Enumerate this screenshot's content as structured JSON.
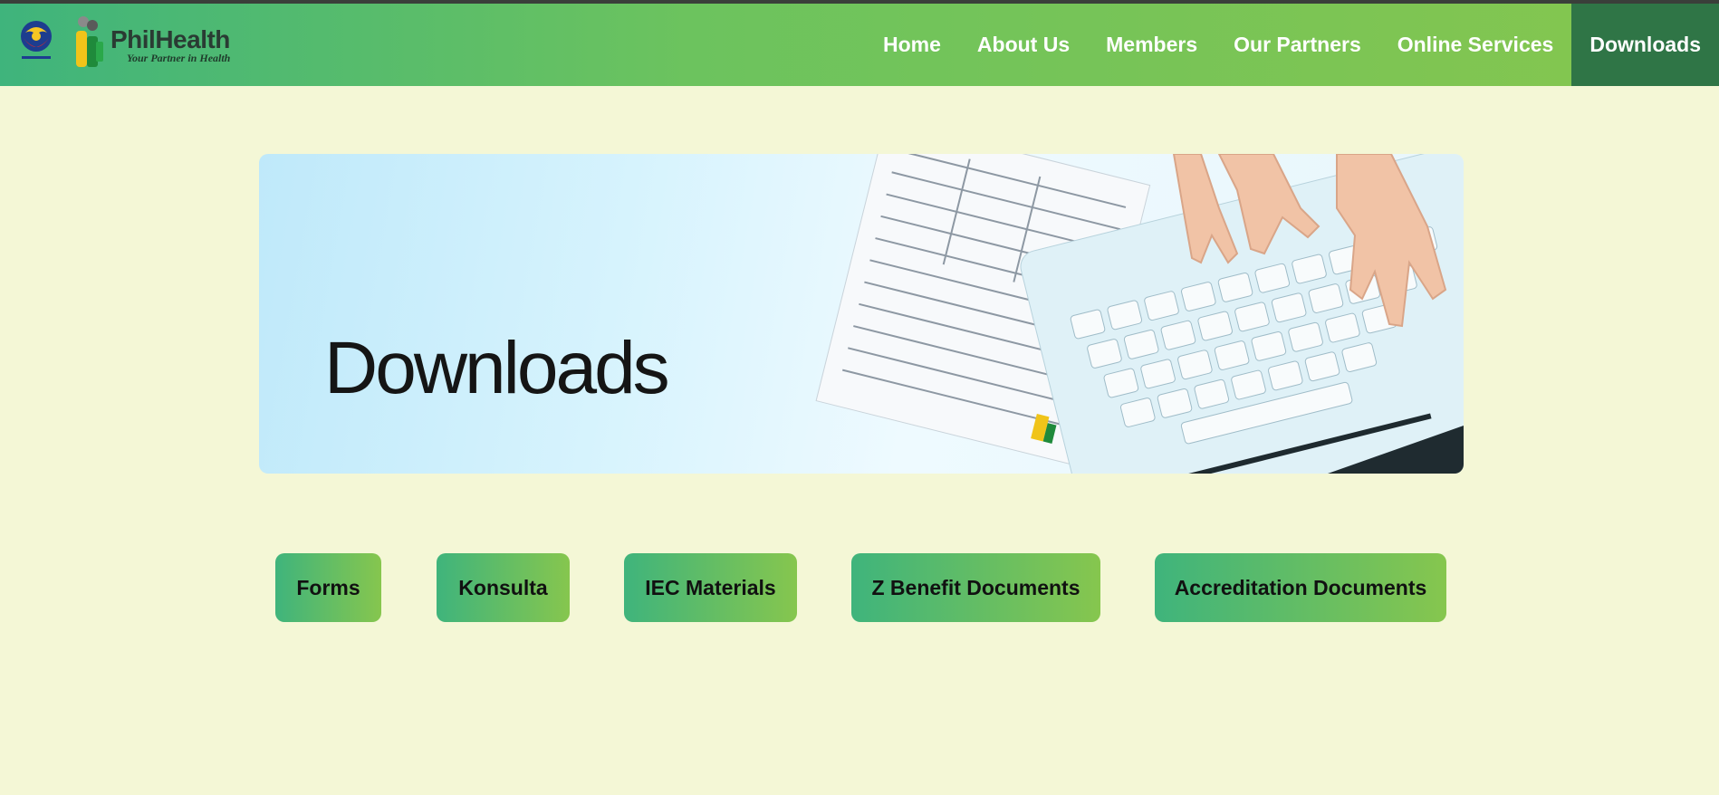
{
  "header": {
    "logo_text": "PhilHealth",
    "logo_tagline": "Your Partner in Health",
    "nav": [
      {
        "label": "Home"
      },
      {
        "label": "About Us"
      },
      {
        "label": "Members"
      },
      {
        "label": "Our Partners"
      },
      {
        "label": "Online Services"
      },
      {
        "label": "Downloads",
        "active": true
      }
    ]
  },
  "banner": {
    "title": "Downloads"
  },
  "categories": [
    {
      "label": "Forms"
    },
    {
      "label": "Konsulta"
    },
    {
      "label": "IEC Materials"
    },
    {
      "label": "Z Benefit Documents"
    },
    {
      "label": "Accreditation Documents"
    }
  ],
  "colors": {
    "page_background": "#f4f7d6",
    "nav_gradient_start": "#3fb47c",
    "nav_gradient_end": "#86c64e",
    "nav_active": "#2f7546"
  }
}
